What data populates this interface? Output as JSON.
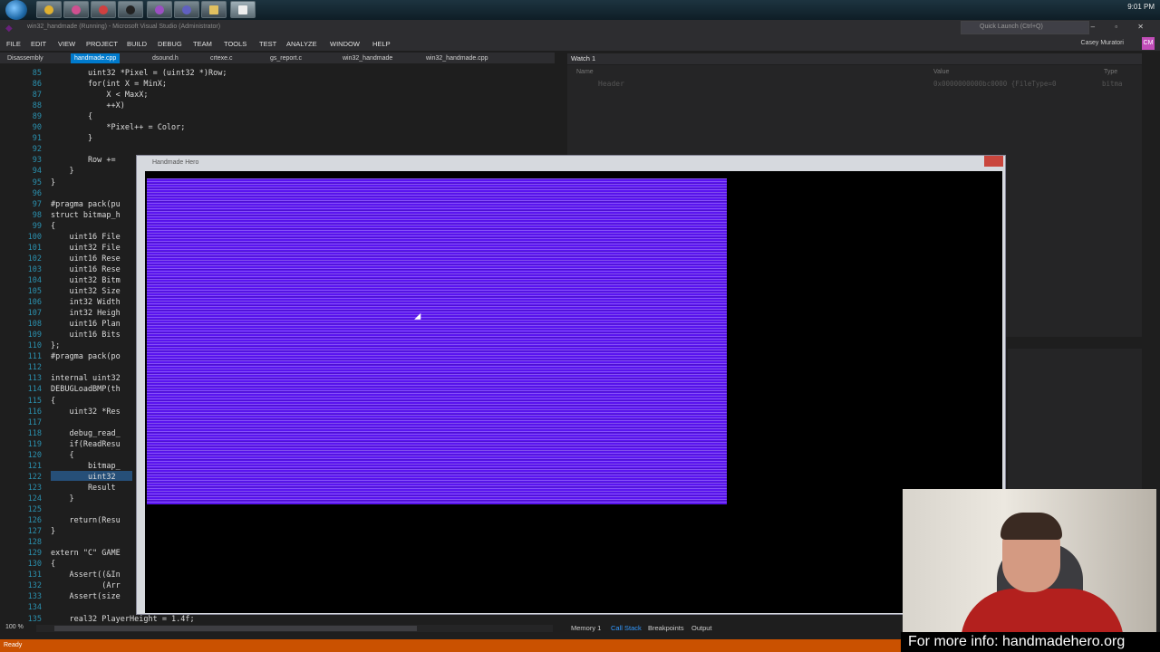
{
  "taskbar": {
    "clock": "9:01 PM",
    "icons": [
      "windows-logo",
      "chrome-icon",
      "firefox-icon",
      "explorer-icon",
      "cmd-icon",
      "emacs-icon",
      "visual-studio-icon",
      "handmade-icon"
    ]
  },
  "vs": {
    "title": "win32_handmade (Running) - Microsoft Visual Studio (Administrator)",
    "quick_launch_placeholder": "Quick Launch (Ctrl+Q)",
    "user": "Casey Muratori",
    "avatar_initials": "CM",
    "menu": [
      "FILE",
      "EDIT",
      "VIEW",
      "PROJECT",
      "BUILD",
      "DEBUG",
      "TEAM",
      "TOOLS",
      "TEST",
      "ANALYZE",
      "WINDOW",
      "HELP"
    ]
  },
  "tabs": [
    {
      "label": "Disassembly",
      "active": false
    },
    {
      "label": "handmade.cpp",
      "active": true
    },
    {
      "label": "dsound.h",
      "active": false
    },
    {
      "label": "crtexe.c",
      "active": false
    },
    {
      "label": "gs_report.c",
      "active": false
    },
    {
      "label": "win32_handmade",
      "active": false
    },
    {
      "label": "win32_handmade.cpp",
      "active": false
    }
  ],
  "code": [
    {
      "ln": "85",
      "text": "        uint32 *Pixel = (uint32 *)Row;"
    },
    {
      "ln": "86",
      "text": "        for(int X = MinX;"
    },
    {
      "ln": "87",
      "text": "            X < MaxX;"
    },
    {
      "ln": "88",
      "text": "            ++X)"
    },
    {
      "ln": "89",
      "text": "        {"
    },
    {
      "ln": "90",
      "text": "            *Pixel++ = Color;"
    },
    {
      "ln": "91",
      "text": "        }"
    },
    {
      "ln": "92",
      "text": ""
    },
    {
      "ln": "93",
      "text": "        Row +="
    },
    {
      "ln": "94",
      "text": "    }"
    },
    {
      "ln": "95",
      "text": "}"
    },
    {
      "ln": "96",
      "text": ""
    },
    {
      "ln": "97",
      "text": "#pragma pack(pu"
    },
    {
      "ln": "98",
      "text": "struct bitmap_h"
    },
    {
      "ln": "99",
      "text": "{"
    },
    {
      "ln": "100",
      "text": "    uint16 File"
    },
    {
      "ln": "101",
      "text": "    uint32 File"
    },
    {
      "ln": "102",
      "text": "    uint16 Rese"
    },
    {
      "ln": "103",
      "text": "    uint16 Rese"
    },
    {
      "ln": "104",
      "text": "    uint32 Bitm"
    },
    {
      "ln": "105",
      "text": "    uint32 Size"
    },
    {
      "ln": "106",
      "text": "    int32 Width"
    },
    {
      "ln": "107",
      "text": "    int32 Heigh"
    },
    {
      "ln": "108",
      "text": "    uint16 Plan"
    },
    {
      "ln": "109",
      "text": "    uint16 Bits"
    },
    {
      "ln": "110",
      "text": "};"
    },
    {
      "ln": "111",
      "text": "#pragma pack(po"
    },
    {
      "ln": "112",
      "text": ""
    },
    {
      "ln": "113",
      "text": "internal uint32"
    },
    {
      "ln": "114",
      "text": "DEBUGLoadBMP(th"
    },
    {
      "ln": "115",
      "text": "{"
    },
    {
      "ln": "116",
      "text": "    uint32 *Res"
    },
    {
      "ln": "117",
      "text": ""
    },
    {
      "ln": "118",
      "text": "    debug_read_"
    },
    {
      "ln": "119",
      "text": "    if(ReadResu"
    },
    {
      "ln": "120",
      "text": "    {"
    },
    {
      "ln": "121",
      "text": "        bitmap_"
    },
    {
      "ln": "122",
      "text": "        uint32"
    },
    {
      "ln": "123",
      "text": "        Result"
    },
    {
      "ln": "124",
      "text": "    }"
    },
    {
      "ln": "125",
      "text": ""
    },
    {
      "ln": "126",
      "text": "    return(Resu"
    },
    {
      "ln": "127",
      "text": "}"
    },
    {
      "ln": "128",
      "text": ""
    },
    {
      "ln": "129",
      "text": "extern \"C\" GAME"
    },
    {
      "ln": "130",
      "text": "{"
    },
    {
      "ln": "131",
      "text": "    Assert((&In"
    },
    {
      "ln": "132",
      "text": "           (Arr"
    },
    {
      "ln": "133",
      "text": "    Assert(size"
    },
    {
      "ln": "134",
      "text": ""
    },
    {
      "ln": "135",
      "text": "    real32 PlayerHeight = 1.4f;"
    }
  ],
  "watch": {
    "title": "Watch 1",
    "col_name": "Name",
    "col_value": "Value",
    "col_type": "Type",
    "row_name": "Header",
    "row_value": "0x0000000000bc0000 {FileType=0",
    "row_type": "bitma"
  },
  "game_window": {
    "title": "Handmade Hero"
  },
  "bottom": {
    "zoom": "100 %",
    "tabs": [
      "Memory 1",
      "Call Stack",
      "Breakpoints",
      "Output"
    ],
    "active_tab": "Call Stack"
  },
  "status": {
    "text": "Ready"
  },
  "webcam": {
    "caption": "For more info: handmadehero.org"
  },
  "colors": {
    "accent": "#007acc",
    "status_bar": "#ca5100",
    "bitmap": "#5a14f0"
  }
}
